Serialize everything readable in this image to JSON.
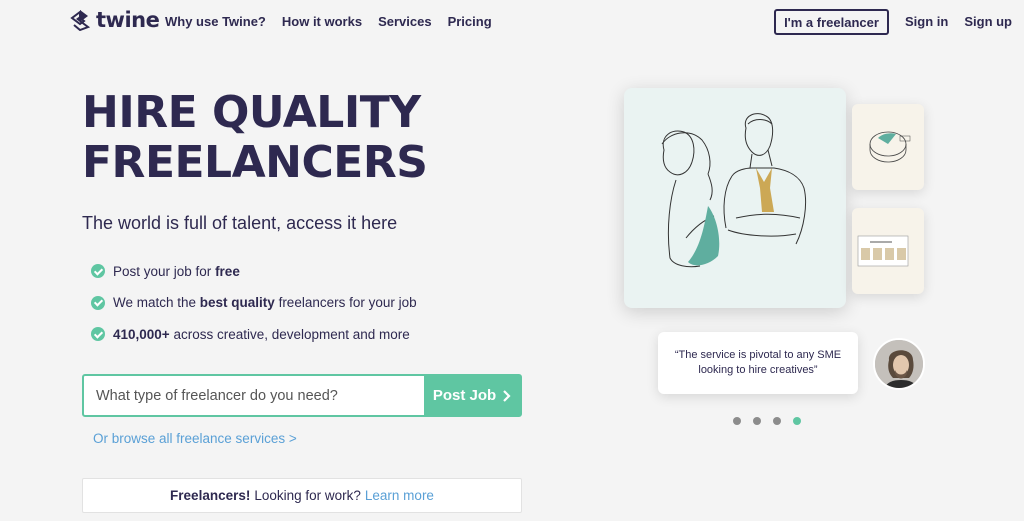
{
  "nav": {
    "logo_text": "twine",
    "links": [
      "Why use Twine?",
      "How it works",
      "Services",
      "Pricing"
    ],
    "freelancer_button": "I'm a freelancer",
    "sign_in": "Sign in",
    "sign_up": "Sign up"
  },
  "hero": {
    "headline_line1": "HIRE QUALITY",
    "headline_line2": "FREELANCERS",
    "subhead": "The world is full of talent, access it here",
    "bullets": [
      {
        "pre": "Post your job for ",
        "bold": "free",
        "post": ""
      },
      {
        "pre": "We match the ",
        "bold": "best quality",
        "post": " freelancers for your job"
      },
      {
        "pre": "",
        "bold": "410,000+",
        "post": " across creative, development and more"
      }
    ]
  },
  "search": {
    "placeholder": "What type of freelancer do you need?",
    "value": "",
    "button_label": "Post Job"
  },
  "browse_link": "Or browse all freelance services >",
  "freelancer_banner": {
    "bold": "Freelancers!",
    "text": "Looking for work?",
    "link": "Learn more"
  },
  "testimonial": {
    "quote": "“The service is pivotal to any SME looking to hire creatives”"
  },
  "carousel": {
    "dot_count": 4,
    "active_index": 3
  },
  "colors": {
    "brand_navy": "#2e2950",
    "accent_green": "#5fc6a2",
    "link_blue": "#5aa0d6"
  },
  "icons": [
    "twine-logo-icon",
    "check-circle-icon",
    "chevron-right-icon"
  ]
}
